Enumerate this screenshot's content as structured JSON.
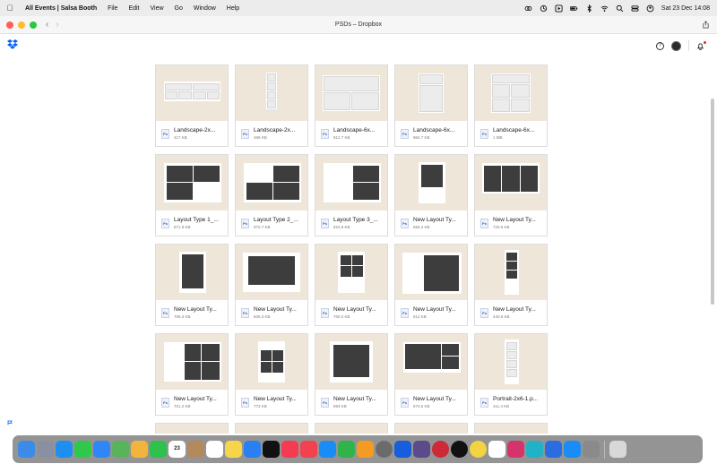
{
  "menubar": {
    "app": "All Events | Salsa Booth",
    "items": [
      "File",
      "Edit",
      "View",
      "Go",
      "Window",
      "Help"
    ],
    "datetime": "Sat 23 Dec  14:08"
  },
  "window": {
    "title": "PSDs – Dropbox"
  },
  "header": {
    "help_glyph": "?"
  },
  "file_type_badge": "Ps",
  "files": [
    {
      "name": "Landscape-2x...",
      "size": "417 KB"
    },
    {
      "name": "Landscape-2x...",
      "size": "466 KB"
    },
    {
      "name": "Landscape-6x...",
      "size": "812.7 KB"
    },
    {
      "name": "Landscape-6x...",
      "size": "864.7 KB"
    },
    {
      "name": "Landscape-6x...",
      "size": "1 MB"
    },
    {
      "name": "Layout Type 1_...",
      "size": "871.9 KB"
    },
    {
      "name": "Layout Type 2_...",
      "size": "872.7 KB"
    },
    {
      "name": "Layout Type 3_...",
      "size": "824.8 KB"
    },
    {
      "name": "New Layout Ty...",
      "size": "665.4 KB"
    },
    {
      "name": "New Layout Ty...",
      "size": "720.6 KB"
    },
    {
      "name": "New Layout Ty...",
      "size": "706.3 KB"
    },
    {
      "name": "New Layout Ty...",
      "size": "605.3 KB"
    },
    {
      "name": "New Layout Ty...",
      "size": "760.2 KB"
    },
    {
      "name": "New Layout Ty...",
      "size": "612 KB"
    },
    {
      "name": "New Layout Ty...",
      "size": "440.6 KB"
    },
    {
      "name": "New Layout Ty...",
      "size": "701.2 KB"
    },
    {
      "name": "New Layout Ty...",
      "size": "773 KB"
    },
    {
      "name": "New Layout Ty...",
      "size": "893 KB"
    },
    {
      "name": "New Layout Ty...",
      "size": "673.6 KB"
    },
    {
      "name": "Portrait-2x6-1.p...",
      "size": "411.4 KB"
    }
  ],
  "dock": {
    "calendar_day": "23",
    "apps": [
      "finder",
      "launchpad",
      "safari",
      "messages",
      "mail",
      "maps",
      "photos",
      "facetime",
      "calendar",
      "contacts",
      "reminders",
      "notes",
      "freeform",
      "tv",
      "music",
      "news",
      "app-store",
      "numbers",
      "pages",
      "settings",
      "bitwarden",
      "alfred",
      "opera",
      "chatgpt",
      "smiley",
      "amazon",
      "instagram",
      "canva",
      "screens",
      "keynote",
      "cleaner",
      "trash"
    ],
    "colors": {
      "finder": "#3d8be8",
      "launchpad": "#8a8fa3",
      "safari": "#1f8ef1",
      "messages": "#2fc84a",
      "mail": "#2f86f4",
      "maps": "#59b35a",
      "photos": "#f3b43c",
      "facetime": "#2ec24c",
      "calendar": "#ffffff",
      "contacts": "#b48a5c",
      "reminders": "#ffffff",
      "notes": "#f6d54a",
      "freeform": "#2a7ff2",
      "tv": "#111111",
      "music": "#f43b53",
      "news": "#f2414f",
      "app-store": "#1a8cf5",
      "numbers": "#30b34a",
      "pages": "#f59a23",
      "settings": "#6b6b6b",
      "bitwarden": "#175ddc",
      "alfred": "#5b4b8a",
      "opera": "#cc2a36",
      "chatgpt": "#111111",
      "smiley": "#f3d342",
      "amazon": "#ffffff",
      "instagram": "#d6336c",
      "canva": "#1fb3c5",
      "screens": "#2b6de0",
      "keynote": "#1a8cf5",
      "cleaner": "#8a8a8a",
      "trash": "#d8d8d8"
    }
  }
}
